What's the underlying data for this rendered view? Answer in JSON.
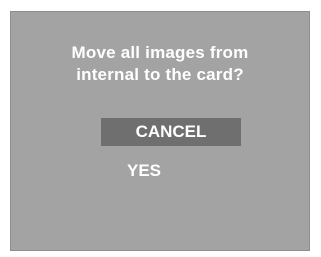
{
  "dialog": {
    "message_lines": [
      "Move all images from",
      "internal to the card?"
    ],
    "options": [
      {
        "label": "CANCEL",
        "selected": true
      },
      {
        "label": "YES",
        "selected": false
      }
    ]
  },
  "colors": {
    "screen_background": "#a3a3a3",
    "selection_highlight": "#6f6f6f",
    "text": "#ffffff"
  }
}
